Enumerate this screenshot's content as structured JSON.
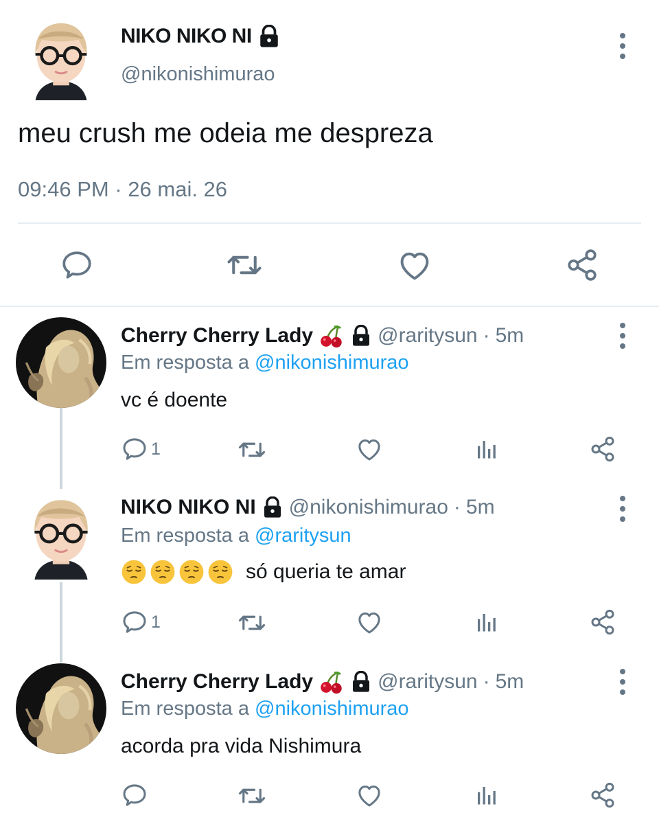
{
  "main_tweet": {
    "name": "NIKO NIKO NI",
    "handle": "@nikonishimurao",
    "text": "meu crush me odeia me despreza",
    "time": "09:46 PM",
    "date_sep": "·",
    "date": "26 mai. 26"
  },
  "replies": [
    {
      "name": "Cherry Cherry Lady",
      "handle": "@raritysun",
      "sep": "·",
      "time": "5m",
      "reply_prefix": "Em resposta a",
      "reply_to": "@nikonishimurao",
      "text": "vc é doente",
      "reply_count": "1"
    },
    {
      "name": "NIKO NIKO NI",
      "handle": "@nikonishimurao",
      "sep": "·",
      "time": "5m",
      "reply_prefix": "Em resposta a",
      "reply_to": "@raritysun",
      "text": "só queria te amar",
      "reply_count": "1"
    },
    {
      "name": "Cherry Cherry Lady",
      "handle": "@raritysun",
      "sep": "·",
      "time": "5m",
      "reply_prefix": "Em resposta a",
      "reply_to": "@nikonishimurao",
      "text": "acorda pra vida Nishimura",
      "reply_count": ""
    }
  ],
  "icons": {
    "lock": "lock-icon",
    "cherry": "cherry-emoji",
    "pensive": "pensive-face-emoji",
    "reply": "reply-icon",
    "retweet": "retweet-icon",
    "like": "heart-icon",
    "analytics": "analytics-icon",
    "share": "share-icon",
    "more": "more-options-icon"
  },
  "colors": {
    "text": "#14171a",
    "secondary": "#657786",
    "link": "#1da1f2",
    "divider": "#e6ecf0"
  }
}
